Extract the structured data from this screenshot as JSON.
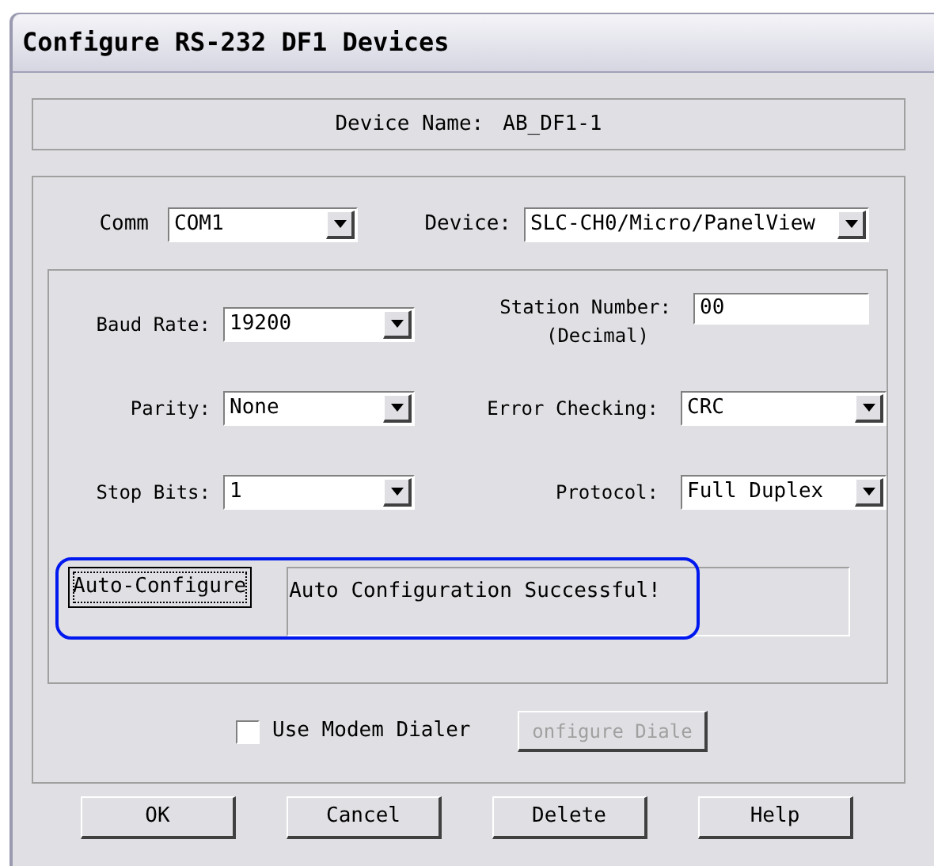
{
  "window": {
    "title": "Configure RS-232 DF1 Devices"
  },
  "device_name": {
    "label": "Device Name:",
    "value": "AB_DF1-1"
  },
  "comm": {
    "label": "Comm",
    "value": "COM1"
  },
  "device": {
    "label": "Device:",
    "value": "SLC-CH0/Micro/PanelView"
  },
  "settings": [
    {
      "kind": "combo",
      "label": "Baud Rate:",
      "value": "19200"
    },
    {
      "kind": "text",
      "label": "Station Number:",
      "sublabel": "(Decimal)",
      "value": "00"
    },
    {
      "kind": "combo",
      "label": "Parity:",
      "value": "None"
    },
    {
      "kind": "combo",
      "label": "Error Checking:",
      "value": "CRC"
    },
    {
      "kind": "combo",
      "label": "Stop Bits:",
      "value": "1"
    },
    {
      "kind": "combo",
      "label": "Protocol:",
      "value": "Full Duplex"
    }
  ],
  "auto_configure": {
    "button": "Auto-Configure",
    "status": "Auto Configuration Successful!"
  },
  "modem_dialer": {
    "label": "Use Modem Dialer",
    "checked": false
  },
  "configure_dialer": {
    "label": "onfigure Diale",
    "disabled": true
  },
  "buttons": [
    "OK",
    "Cancel",
    "Delete",
    "Help"
  ]
}
